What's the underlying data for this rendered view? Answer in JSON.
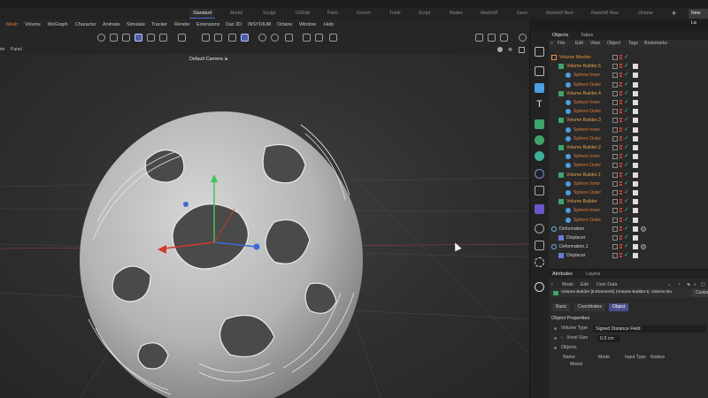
{
  "layouts": {
    "tabs": [
      "Standard",
      "Model",
      "Sculpt",
      "UVEdit",
      "Paint",
      "Groom",
      "Track",
      "Script",
      "Nodes",
      "Redshift",
      "Dave",
      "Redshift Best",
      "Redshift New",
      "Octane"
    ],
    "active": "Standard",
    "new_label": "New La"
  },
  "menu": [
    "Mesh",
    "Volume",
    "MoGraph",
    "Character",
    "Animate",
    "Simulate",
    "Tracker",
    "Render",
    "Extensions",
    "Daz 3D",
    "INSYDIUM",
    "Octane",
    "Window",
    "Help"
  ],
  "viewport": {
    "filter_label": "ter",
    "panel_label": "Panel",
    "camera_label": "Default Camera ⁝▸"
  },
  "object_manager": {
    "tabs": [
      "Objects",
      "Takes"
    ],
    "menu": [
      "File",
      "Edit",
      "View",
      "Object",
      "Tags",
      "Bookmarks"
    ],
    "rows": [
      {
        "name": "Volume Mesher",
        "level": 0,
        "kind": "mesher",
        "color": "#e7903c"
      },
      {
        "name": "Volume Builder.5",
        "level": 1,
        "kind": "builder",
        "color": "#e7a14a"
      },
      {
        "name": "Sphere Inner",
        "level": 2,
        "kind": "sphere",
        "color": "#e07b3a"
      },
      {
        "name": "Sphere Outer",
        "level": 2,
        "kind": "sphere",
        "color": "#e07b3a"
      },
      {
        "name": "Volume Builder.4",
        "level": 1,
        "kind": "builder",
        "color": "#e7a14a"
      },
      {
        "name": "Sphere Inner",
        "level": 2,
        "kind": "sphere",
        "color": "#e07b3a"
      },
      {
        "name": "Sphere Outer",
        "level": 2,
        "kind": "sphere",
        "color": "#e07b3a"
      },
      {
        "name": "Volume Builder.3",
        "level": 1,
        "kind": "builder",
        "color": "#e7a14a"
      },
      {
        "name": "Sphere Inner",
        "level": 2,
        "kind": "sphere",
        "color": "#e07b3a"
      },
      {
        "name": "Sphere Outer",
        "level": 2,
        "kind": "sphere",
        "color": "#e07b3a"
      },
      {
        "name": "Volume Builder.2",
        "level": 1,
        "kind": "builder",
        "color": "#e7a14a"
      },
      {
        "name": "Sphere Inner",
        "level": 2,
        "kind": "sphere",
        "color": "#e07b3a"
      },
      {
        "name": "Sphere Outer",
        "level": 2,
        "kind": "sphere",
        "color": "#e07b3a"
      },
      {
        "name": "Volume Builder.1",
        "level": 1,
        "kind": "builder",
        "color": "#e7a14a"
      },
      {
        "name": "Sphere Inner",
        "level": 2,
        "kind": "sphere",
        "color": "#e07b3a"
      },
      {
        "name": "Sphere Outer",
        "level": 2,
        "kind": "sphere",
        "color": "#e07b3a"
      },
      {
        "name": "Volume Builder",
        "level": 1,
        "kind": "builder",
        "color": "#e7a14a"
      },
      {
        "name": "Sphere Inner",
        "level": 2,
        "kind": "sphere",
        "color": "#e07b3a"
      },
      {
        "name": "Sphere Outer",
        "level": 2,
        "kind": "sphere",
        "color": "#e07b3a"
      },
      {
        "name": "Deformation",
        "level": 0,
        "kind": "null",
        "color": "#cfcfcf"
      },
      {
        "name": "Displacer",
        "level": 1,
        "kind": "displacer",
        "color": "#cfcfcf"
      },
      {
        "name": "Deformation.1",
        "level": 0,
        "kind": "null",
        "color": "#cfcfcf"
      },
      {
        "name": "Displacer",
        "level": 1,
        "kind": "displacer",
        "color": "#cfcfcf"
      }
    ]
  },
  "attributes": {
    "tabs": [
      "Attributes",
      "Layers"
    ],
    "menu": [
      "Mode",
      "Edit",
      "User Data"
    ],
    "object_title": "Volume Builder [6 Elements] (Volume Builder.5, Volume Bu",
    "custom_label": "Custom",
    "sub_tabs": [
      "Basic",
      "Coordinates",
      "Object"
    ],
    "active_sub_tab": "Object",
    "section": "Object Properties",
    "volume_type_label": "Volume Type",
    "volume_type_value": "Signed Distance Field",
    "voxel_size_label": "Voxel Size",
    "voxel_size_value": "0.3 cm",
    "objects_label": "Objects",
    "columns": [
      "Name",
      "Mode",
      "Input Type",
      "Radius"
    ],
    "mixed_value": "Mixed"
  },
  "colors": {
    "accent": "#4a6ed6",
    "check": "#3fc45a",
    "orange": "#e7903c"
  }
}
